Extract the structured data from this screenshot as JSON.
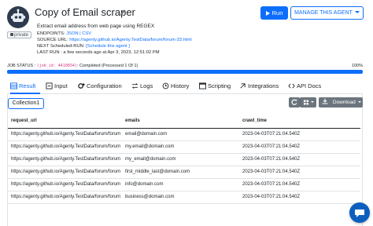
{
  "agent": {
    "title": "Copy of Email scraper",
    "privacy_label": "private",
    "description": "Extract email address from web page using REGEX",
    "endpoints_label": "ENDPOINTS:",
    "endpoints_value": "JSON | CSV",
    "source_url_label": "SOURCE URL:",
    "source_url": "https://agenty.github.io/Agenty.TestData/forum/forum-33.html",
    "next_run_label": "NEXT Scheduled-RUN:",
    "next_run_value": "[Schedule this agent ]",
    "last_run_label": "LAST RUN :",
    "last_run_value": "a few seconds ago at Apr 3, 2023, 12:51:02 PM"
  },
  "actions": {
    "run_label": "Run",
    "manage_label": "MANAGE THIS AGENT"
  },
  "job": {
    "status_label": "JOB STATUS :",
    "job_id": "(job_id: 4410654)",
    "status_text": ": Completed (Processed 1 Of 1)",
    "percent_label": "100%",
    "progress_fraction": 1.0
  },
  "tabs": [
    {
      "label": "Result",
      "icon": "table-icon"
    },
    {
      "label": "Input",
      "icon": "input-icon"
    },
    {
      "label": "Configuration",
      "icon": "gears-icon"
    },
    {
      "label": "Logs",
      "icon": "logs-icon"
    },
    {
      "label": "History",
      "icon": "history-icon"
    },
    {
      "label": "Scripting",
      "icon": "scripting-icon"
    },
    {
      "label": "Integrations",
      "icon": "integrations-icon"
    },
    {
      "label": "API Docs",
      "icon": "api-icon"
    }
  ],
  "result": {
    "collection_label": "Collection1",
    "download_label": "Download",
    "columns": [
      "request_url",
      "emails",
      "crawl_time"
    ],
    "rows": [
      [
        "https://agenty.github.io/Agenty.TestData/forum/forum",
        "email@domain.com",
        "2023-04-03T07:21:04.540Z"
      ],
      [
        "https://agenty.github.io/Agenty.TestData/forum/forum",
        "my.email@domain.com",
        "2023-04-03T07:21:04.540Z"
      ],
      [
        "https://agenty.github.io/Agenty.TestData/forum/forum",
        "my_email@domain.com",
        "2023-04-03T07:21:04.540Z"
      ],
      [
        "https://agenty.github.io/Agenty.TestData/forum/forum",
        "first_middle_last@domain.com",
        "2023-04-03T07:21:04.540Z"
      ],
      [
        "https://agenty.github.io/Agenty.TestData/forum/forum",
        "info@domain.com",
        "2023-04-03T07:21:04.540Z"
      ],
      [
        "https://agenty.github.io/Agenty.TestData/forum/forum",
        "business@domain.com",
        "2023-04-03T07:21:04.540Z"
      ]
    ]
  },
  "colors": {
    "primary": "#0d6efd",
    "secondary_button": "#6c757d",
    "job_id": "#d63384",
    "chat": "#0d5fbe"
  }
}
